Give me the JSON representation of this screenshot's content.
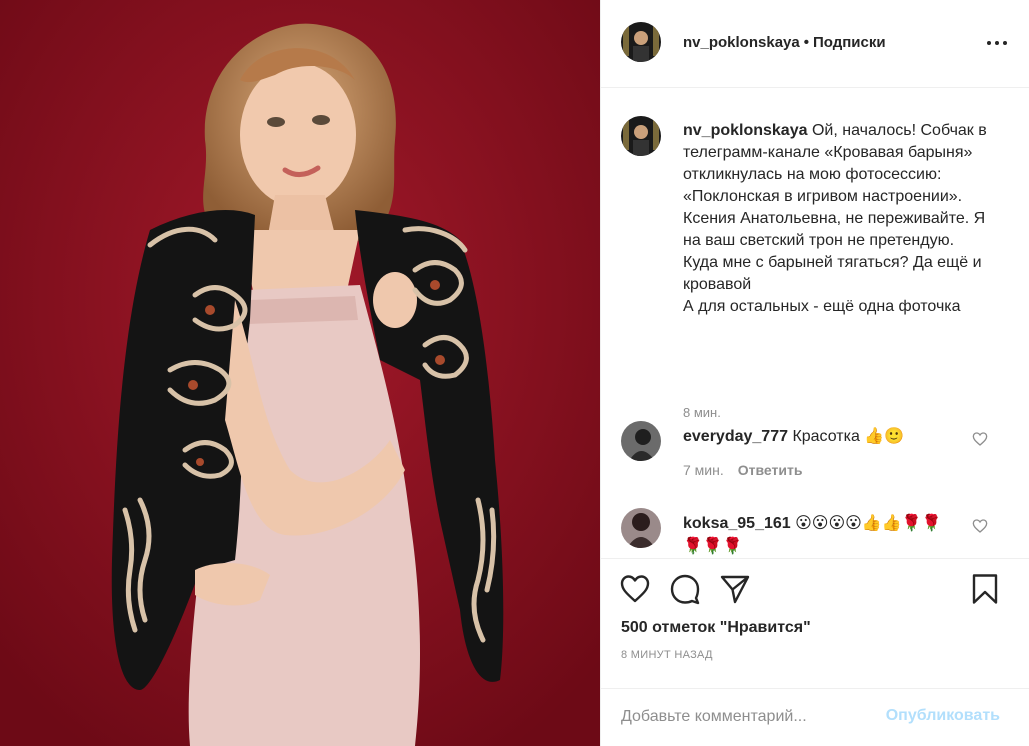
{
  "post": {
    "photo_alt": "",
    "header": {
      "username": "nv_poklonskaya",
      "separator": "•",
      "follow_label": "Подписки",
      "more_icon": "more-horizontal-icon"
    },
    "caption": {
      "username": "nv_poklonskaya",
      "text": "Ой, началось! Собчак в телеграмм-канале «Кровавая барыня» откликнулась на мою фотосессию: «Поклонская в игривом настроении». Ксения Анатольевна, не переживайте. Я на ваш светский трон не претендую. Куда мне с барыней тягаться? Да ещё и кровавой\nА для остальных - ещё одна фоточка",
      "time": "8 мин."
    },
    "comments": [
      {
        "username": "everyday_777",
        "text": "Красотка",
        "emoji": "👍🙂",
        "time": "7 мин.",
        "reply_label": "Ответить"
      },
      {
        "username": "koksa_95_161",
        "text": "",
        "emoji": "😮😮😮😮👍👍🌹🌹 🌹🌹🌹",
        "time": "",
        "reply_label": ""
      }
    ],
    "actions": {
      "like_icon": "heart-icon",
      "comment_icon": "comment-bubble-icon",
      "share_icon": "paper-plane-icon",
      "save_icon": "bookmark-icon"
    },
    "likes_text": "500 отметок \"Нравится\"",
    "date_text": "8 МИНУТ НАЗАД",
    "comment_box": {
      "placeholder": "Добавьте комментарий...",
      "publish_label": "Опубликовать"
    }
  },
  "colors": {
    "photo_background": "#8a0f1f",
    "dress": "#e8c9c4",
    "jacket": "#141414",
    "embroidery": "#d8c2a8",
    "publish_disabled": "#b2dffc",
    "muted_text": "#8e8e8e"
  }
}
